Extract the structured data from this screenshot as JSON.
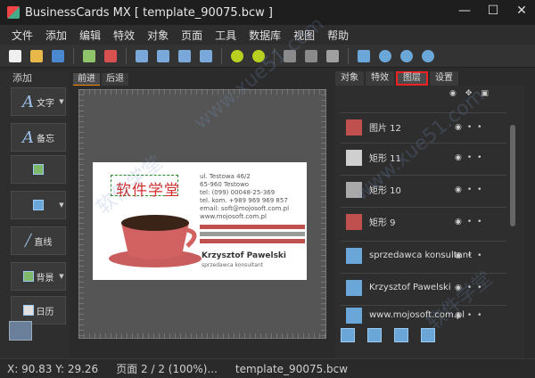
{
  "window": {
    "title": "BusinessCards MX [ template_90075.bcw ]",
    "controls": [
      "—",
      "☐",
      "✕"
    ]
  },
  "menu": [
    "文件",
    "添加",
    "编辑",
    "特效",
    "对象",
    "页面",
    "工具",
    "数据库",
    "视图",
    "帮助"
  ],
  "left_panel": {
    "title": "添加",
    "buttons": [
      {
        "label": "文字",
        "icon": "text-tool-icon"
      },
      {
        "label": "备忘",
        "icon": "memo-icon"
      },
      {
        "label": "",
        "icon": "image-icon"
      },
      {
        "label": "",
        "icon": "shape-icon"
      },
      {
        "label": "直线",
        "icon": "line-icon"
      },
      {
        "label": "背景",
        "icon": "background-icon"
      },
      {
        "label": "日历",
        "icon": "calendar-icon"
      }
    ]
  },
  "nav_tabs": [
    "前进",
    "后退"
  ],
  "card": {
    "logo_text": "软件学堂",
    "info_lines": [
      "ul. Testowa 46/2",
      "65-960 Testowo",
      "tel: (099) 00048-25-369",
      "tel. kom. +989 969 969 857",
      "email: soft@mojosoft.com.pl",
      "www.mojosoft.com.pl"
    ],
    "name": "Krzysztof Pawelski",
    "role": "sprzedawca konsultant"
  },
  "right_tabs": [
    {
      "label": "对象",
      "active": false
    },
    {
      "label": "特效",
      "active": false
    },
    {
      "label": "图层",
      "active": true
    },
    {
      "label": "设置",
      "active": false
    }
  ],
  "layers": [
    {
      "name": "图片 12",
      "thumb": "#c0504d"
    },
    {
      "name": "矩形 11",
      "thumb": "#cfcfcf"
    },
    {
      "name": "矩形 10",
      "thumb": "#a9a9a9"
    },
    {
      "name": "矩形 9",
      "thumb": "#c0504d"
    },
    {
      "name": "sprzedawca konsultant",
      "thumb": "#6aa6d8"
    },
    {
      "name": "Krzysztof Pawelski",
      "thumb": "#6aa6d8"
    },
    {
      "name": "www.mojosoft.com.pl",
      "thumb": "#6aa6d8"
    }
  ],
  "status": {
    "coords": "X: 90.83 Y: 29.26",
    "page": "页面 2 / 2 (100%)...",
    "file": "template_90075.bcw"
  },
  "watermarks": [
    "软件学堂",
    "www.xue51.com",
    "软件学堂",
    "www.xue51.com"
  ]
}
